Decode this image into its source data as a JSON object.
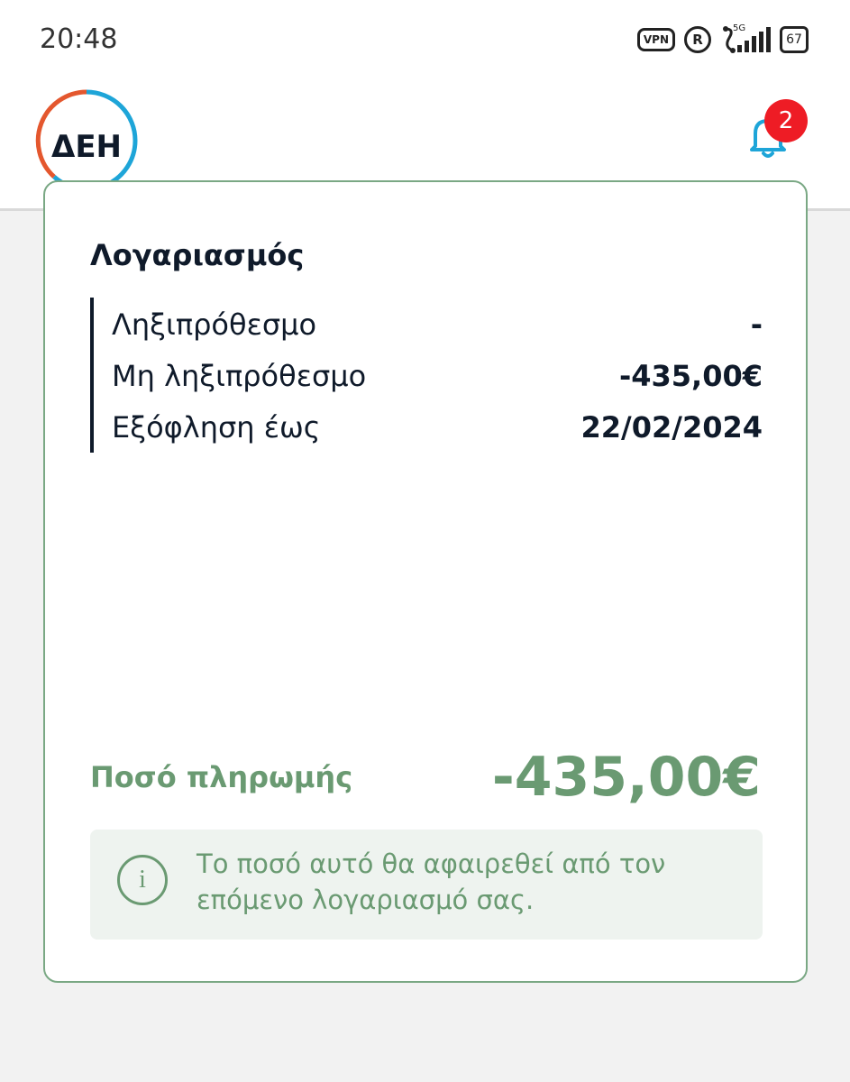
{
  "status_bar": {
    "time": "20:48",
    "vpn_label": "VPN",
    "r_label": "R",
    "network_label": "5G",
    "battery_level": "67",
    "icons": [
      "vpn-icon",
      "registered-icon",
      "network-5g-icon",
      "signal-icon",
      "battery-icon"
    ]
  },
  "header": {
    "logo_text": "ΔΕΗ",
    "notifications_count": "2",
    "colors": {
      "logo_orange": "#e4572e",
      "logo_blue": "#1ea5d8",
      "bell": "#1ea5d8",
      "badge": "#ee1c25"
    }
  },
  "account": {
    "title": "Λογαριασμός",
    "rows": [
      {
        "label": "Ληξιπρόθεσμο",
        "value": "-"
      },
      {
        "label": "Μη ληξιπρόθεσμο",
        "value": "-435,00€"
      },
      {
        "label": "Εξόφληση έως",
        "value": "22/02/2024"
      }
    ],
    "payment_label": "Ποσό πληρωμής",
    "payment_amount": "-435,00€",
    "info_text": "Το ποσό αυτό θα αφαιρεθεί από τον επόμενο λογαριασμό σας.",
    "accent_color": "#6a9a72"
  }
}
